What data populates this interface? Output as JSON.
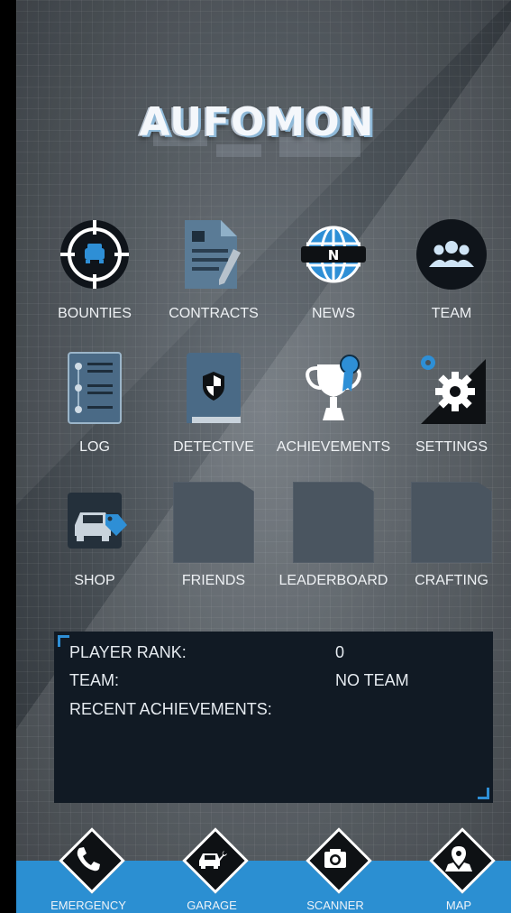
{
  "app": {
    "title": "AUFOMON"
  },
  "menu": {
    "row1": [
      {
        "label": "BOUNTIES",
        "icon": "car-target-icon"
      },
      {
        "label": "CONTRACTS",
        "icon": "document-pen-icon"
      },
      {
        "label": "NEWS",
        "icon": "globe-news-icon"
      },
      {
        "label": "TEAM",
        "icon": "team-icon"
      }
    ],
    "row2": [
      {
        "label": "LOG",
        "icon": "log-list-icon"
      },
      {
        "label": "DETECTIVE",
        "icon": "detective-book-icon"
      },
      {
        "label": "ACHIEVEMENTS",
        "icon": "trophy-icon"
      },
      {
        "label": "SETTINGS",
        "icon": "gear-icon"
      }
    ],
    "row3": [
      {
        "label": "SHOP",
        "icon": "car-tag-icon"
      },
      {
        "label": "FRIENDS",
        "icon": "locked-placeholder-icon"
      },
      {
        "label": "LEADERBOARD",
        "icon": "locked-placeholder-icon"
      },
      {
        "label": "CRAFTING",
        "icon": "locked-placeholder-icon"
      }
    ]
  },
  "player": {
    "rank_label": "PLAYER RANK:",
    "rank_value": "0",
    "team_label": "TEAM:",
    "team_value": "NO TEAM",
    "achievements_label": "RECENT ACHIEVEMENTS:"
  },
  "bottom_nav": [
    {
      "label": "EMERGENCY",
      "icon": "phone-icon"
    },
    {
      "label": "GARAGE",
      "icon": "car-wrench-icon"
    },
    {
      "label": "SCANNER",
      "icon": "camera-icon"
    },
    {
      "label": "MAP",
      "icon": "map-pin-icon"
    }
  ],
  "colors": {
    "accent": "#2b8fd2",
    "panel": "#111a24",
    "icon_blue": "#2e8fd6"
  }
}
